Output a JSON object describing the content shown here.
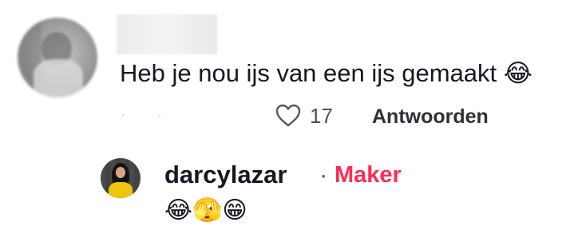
{
  "comment": {
    "text": "Heb je nou ijs van een ijs gemaakt",
    "emoji": "😂",
    "likes": "17",
    "reply_label": "Antwoorden"
  },
  "reply": {
    "username": "darcylazar",
    "separator": "·",
    "badge": "Maker",
    "emojis": "😂🫣😁"
  },
  "colors": {
    "badge": "#fe2c55",
    "text": "#161823",
    "muted": "#505050"
  },
  "icons": {
    "like": "heart-outline-icon"
  }
}
